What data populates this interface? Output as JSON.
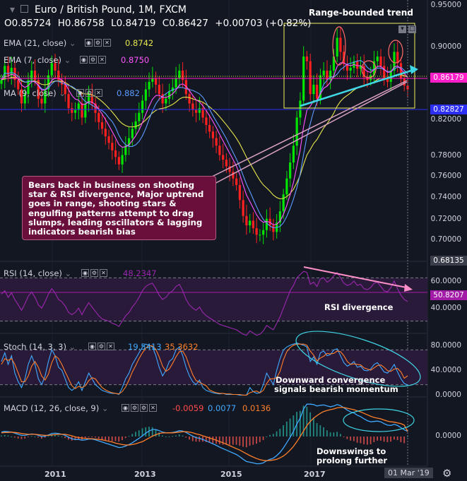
{
  "header": {
    "title": "Euro / British Pound, 1M, FXCM",
    "ohlc": {
      "o_label": "O",
      "o": "0.85724",
      "h_label": "H",
      "h": "0.86758",
      "l_label": "L",
      "l": "0.84719",
      "c_label": "C",
      "c": "0.86427",
      "change": "+0.00703 (+0.82%)"
    }
  },
  "indicators": {
    "ema21": {
      "label": "EMA (21, close)",
      "value": "0.8742"
    },
    "ema7": {
      "label": "EMA (7, close)",
      "value": "0.8750"
    },
    "ma9": {
      "label": "MA (9, close)",
      "value": "0.882"
    },
    "rsi": {
      "label": "RSI (14, close)",
      "value": "48.2347"
    },
    "stoch": {
      "label": "Stoch (14, 3, 3)",
      "k": "19.5413",
      "d": "35.3632"
    },
    "macd": {
      "label": "MACD (12, 26, close, 9)",
      "v1": "-0.0059",
      "v2": "0.0077",
      "v3": "0.0136"
    }
  },
  "price_axis": {
    "ticks": [
      "0.95000",
      "0.90000",
      "0.86179",
      "0.82827",
      "0.82000",
      "0.78000",
      "0.76000",
      "0.74000",
      "0.72000",
      "0.70000",
      "0.68135"
    ],
    "current": "0.86179",
    "support": "0.82827",
    "bottom": "0.68135"
  },
  "rsi_axis": {
    "ticks": [
      "60.0000",
      "50.8207",
      "40.0000"
    ]
  },
  "stoch_axis": {
    "ticks": [
      "80.0000",
      "40.0000",
      "0.0000"
    ]
  },
  "macd_axis": {
    "ticks": [
      "0.0000"
    ]
  },
  "time_axis": {
    "labels": [
      "2011",
      "2013",
      "2015",
      "2017"
    ],
    "cursor": "01 Mar '19"
  },
  "annotations": {
    "range_trend": "Range-bounded trend",
    "bear_note": "Bears back in business on shooting star & RSI divergence, Major uptrend goes in range, shooting stars & engulfing patterns attempt to drag slumps, leading oscillators & lagging indicators bearish bias",
    "rsi_div": "RSI divergence",
    "stoch_note_1": "Downward convergence",
    "stoch_note_2": "signals bearish momentum",
    "macd_note_1": "Downswings to",
    "macd_note_2": "prolong further"
  },
  "colors": {
    "bg": "#131722",
    "up": "#00e600",
    "down": "#ff2020",
    "ema21": "#e6e64d",
    "ema7": "#ff55ff",
    "ma9": "#5b9bff",
    "rsi": "#9c27b0",
    "stoch_k": "#3fa9ff",
    "stoch_d": "#ff7f2a",
    "cyan": "#3fd6e6",
    "pink": "#ff8fc8"
  },
  "series": {
    "close": [
      0.87,
      0.885,
      0.875,
      0.883,
      0.87,
      0.86,
      0.845,
      0.855,
      0.87,
      0.88,
      0.87,
      0.85,
      0.845,
      0.86,
      0.875,
      0.888,
      0.88,
      0.87,
      0.865,
      0.855,
      0.84,
      0.835,
      0.838,
      0.845,
      0.83,
      0.845,
      0.855,
      0.845,
      0.835,
      0.825,
      0.818,
      0.81,
      0.803,
      0.795,
      0.788,
      0.78,
      0.79,
      0.8,
      0.808,
      0.818,
      0.826,
      0.835,
      0.848,
      0.86,
      0.868,
      0.872,
      0.865,
      0.855,
      0.845,
      0.85,
      0.858,
      0.862,
      0.872,
      0.88,
      0.87,
      0.855,
      0.845,
      0.838,
      0.835,
      0.84,
      0.83,
      0.822,
      0.815,
      0.808,
      0.8,
      0.79,
      0.785,
      0.778,
      0.772,
      0.765,
      0.758,
      0.742,
      0.725,
      0.715,
      0.72,
      0.712,
      0.705,
      0.705,
      0.71,
      0.722,
      0.715,
      0.708,
      0.718,
      0.73,
      0.748,
      0.765,
      0.782,
      0.8,
      0.83,
      0.848,
      0.895,
      0.89,
      0.855,
      0.865,
      0.85,
      0.875,
      0.88,
      0.87,
      0.88,
      0.895,
      0.915,
      0.9,
      0.887,
      0.88,
      0.883,
      0.89,
      0.882,
      0.885,
      0.873,
      0.87,
      0.875,
      0.89,
      0.895,
      0.885,
      0.872,
      0.868,
      0.88,
      0.9,
      0.888,
      0.872,
      0.864,
      0.86
    ],
    "rsi": [
      55,
      58,
      52,
      56,
      50,
      45,
      40,
      46,
      53,
      57,
      52,
      45,
      42,
      48,
      55,
      60,
      56,
      50,
      48,
      44,
      38,
      36,
      38,
      42,
      36,
      42,
      47,
      43,
      39,
      35,
      32,
      31,
      30,
      28,
      27,
      25,
      30,
      35,
      38,
      43,
      47,
      52,
      58,
      62,
      64,
      65,
      60,
      54,
      50,
      52,
      56,
      58,
      62,
      64,
      58,
      50,
      45,
      42,
      40,
      43,
      38,
      35,
      33,
      31,
      29,
      27,
      26,
      25,
      24,
      23,
      22,
      20,
      18,
      17,
      21,
      19,
      17,
      18,
      21,
      26,
      24,
      22,
      28,
      34,
      42,
      50,
      58,
      63,
      70,
      73,
      76,
      75,
      64,
      66,
      62,
      69,
      70,
      66,
      68,
      72,
      75,
      70,
      65,
      63,
      64,
      67,
      63,
      64,
      60,
      59,
      61,
      65,
      66,
      62,
      58,
      57,
      61,
      67,
      60,
      54,
      50,
      48
    ],
    "stoch_k": [
      60,
      75,
      55,
      70,
      40,
      25,
      15,
      30,
      55,
      70,
      55,
      30,
      20,
      35,
      60,
      80,
      70,
      50,
      45,
      30,
      15,
      10,
      15,
      25,
      10,
      25,
      40,
      30,
      20,
      15,
      10,
      8,
      6,
      5,
      5,
      3,
      15,
      30,
      40,
      55,
      65,
      75,
      85,
      90,
      88,
      85,
      70,
      50,
      35,
      45,
      60,
      65,
      80,
      85,
      70,
      50,
      35,
      25,
      20,
      28,
      15,
      10,
      8,
      6,
      5,
      4,
      5,
      3,
      3,
      3,
      3,
      2,
      2,
      2,
      15,
      8,
      5,
      6,
      20,
      40,
      30,
      20,
      45,
      65,
      80,
      85,
      88,
      90,
      92,
      90,
      88,
      85,
      60,
      68,
      55,
      75,
      78,
      70,
      72,
      80,
      82,
      70,
      58,
      52,
      55,
      60,
      50,
      52,
      45,
      44,
      47,
      55,
      58,
      50,
      42,
      40,
      46,
      55,
      42,
      30,
      22,
      19.5
    ],
    "stoch_d": [
      55,
      65,
      62,
      65,
      55,
      40,
      25,
      25,
      35,
      52,
      60,
      50,
      35,
      28,
      38,
      58,
      70,
      65,
      55,
      42,
      30,
      18,
      13,
      17,
      15,
      18,
      27,
      32,
      30,
      22,
      15,
      11,
      8,
      6,
      5,
      4,
      8,
      16,
      28,
      42,
      53,
      65,
      75,
      83,
      87,
      87,
      81,
      68,
      52,
      43,
      47,
      57,
      68,
      77,
      78,
      68,
      52,
      37,
      27,
      24,
      21,
      18,
      11,
      8,
      6,
      5,
      5,
      4,
      4,
      3,
      3,
      3,
      2,
      2,
      6,
      8,
      9,
      6,
      10,
      22,
      30,
      30,
      32,
      43,
      63,
      77,
      84,
      88,
      90,
      90,
      90,
      88,
      78,
      71,
      61,
      66,
      69,
      74,
      73,
      74,
      78,
      77,
      70,
      60,
      55,
      56,
      55,
      54,
      49,
      47,
      45,
      49,
      53,
      54,
      50,
      44,
      43,
      47,
      48,
      42,
      31,
      35.4
    ],
    "macd": [
      0.012,
      0.014,
      0.013,
      0.012,
      0.009,
      0.006,
      0.003,
      0.003,
      0.005,
      0.007,
      0.006,
      0.003,
      0.0,
      0.001,
      0.004,
      0.008,
      0.009,
      0.008,
      0.006,
      0.003,
      -0.002,
      -0.006,
      -0.008,
      -0.008,
      -0.01,
      -0.009,
      -0.007,
      -0.007,
      -0.009,
      -0.012,
      -0.015,
      -0.018,
      -0.021,
      -0.024,
      -0.027,
      -0.03,
      -0.029,
      -0.026,
      -0.022,
      -0.017,
      -0.011,
      -0.005,
      0.002,
      0.009,
      0.015,
      0.019,
      0.019,
      0.016,
      0.012,
      0.01,
      0.01,
      0.011,
      0.013,
      0.016,
      0.015,
      0.011,
      0.006,
      0.001,
      -0.003,
      -0.005,
      -0.008,
      -0.012,
      -0.016,
      -0.02,
      -0.024,
      -0.029,
      -0.033,
      -0.037,
      -0.041,
      -0.045,
      -0.049,
      -0.055,
      -0.062,
      -0.068,
      -0.07,
      -0.072,
      -0.074,
      -0.074,
      -0.072,
      -0.066,
      -0.062,
      -0.059,
      -0.052,
      -0.043,
      -0.031,
      -0.017,
      -0.002,
      0.014,
      0.034,
      0.05,
      0.075,
      0.088,
      0.088,
      0.087,
      0.083,
      0.085,
      0.086,
      0.083,
      0.081,
      0.083,
      0.087,
      0.084,
      0.078,
      0.072,
      0.067,
      0.064,
      0.058,
      0.054,
      0.048,
      0.043,
      0.04,
      0.041,
      0.042,
      0.04,
      0.035,
      0.031,
      0.03,
      0.033,
      0.03,
      0.024,
      0.018,
      0.014
    ],
    "macd_signal": [
      0.01,
      0.011,
      0.011,
      0.012,
      0.011,
      0.01,
      0.008,
      0.007,
      0.006,
      0.006,
      0.006,
      0.005,
      0.004,
      0.003,
      0.003,
      0.004,
      0.005,
      0.006,
      0.006,
      0.006,
      0.004,
      0.002,
      -0.001,
      -0.003,
      -0.004,
      -0.005,
      -0.006,
      -0.006,
      -0.007,
      -0.008,
      -0.009,
      -0.011,
      -0.013,
      -0.015,
      -0.018,
      -0.02,
      -0.022,
      -0.023,
      -0.023,
      -0.022,
      -0.02,
      -0.017,
      -0.014,
      -0.009,
      -0.004,
      0.001,
      0.005,
      0.008,
      0.01,
      0.01,
      0.01,
      0.01,
      0.011,
      0.012,
      0.013,
      0.013,
      0.012,
      0.01,
      0.007,
      0.005,
      0.002,
      -0.001,
      -0.004,
      -0.007,
      -0.01,
      -0.014,
      -0.017,
      -0.021,
      -0.025,
      -0.029,
      -0.033,
      -0.037,
      -0.042,
      -0.047,
      -0.052,
      -0.056,
      -0.06,
      -0.063,
      -0.065,
      -0.066,
      -0.065,
      -0.064,
      -0.062,
      -0.058,
      -0.053,
      -0.046,
      -0.037,
      -0.027,
      -0.014,
      0.0,
      0.015,
      0.03,
      0.041,
      0.05,
      0.057,
      0.063,
      0.068,
      0.071,
      0.073,
      0.075,
      0.078,
      0.079,
      0.079,
      0.077,
      0.075,
      0.073,
      0.07,
      0.067,
      0.063,
      0.059,
      0.055,
      0.052,
      0.05,
      0.048,
      0.045,
      0.042,
      0.04,
      0.039,
      0.037,
      0.035,
      0.031,
      0.0136
    ]
  }
}
